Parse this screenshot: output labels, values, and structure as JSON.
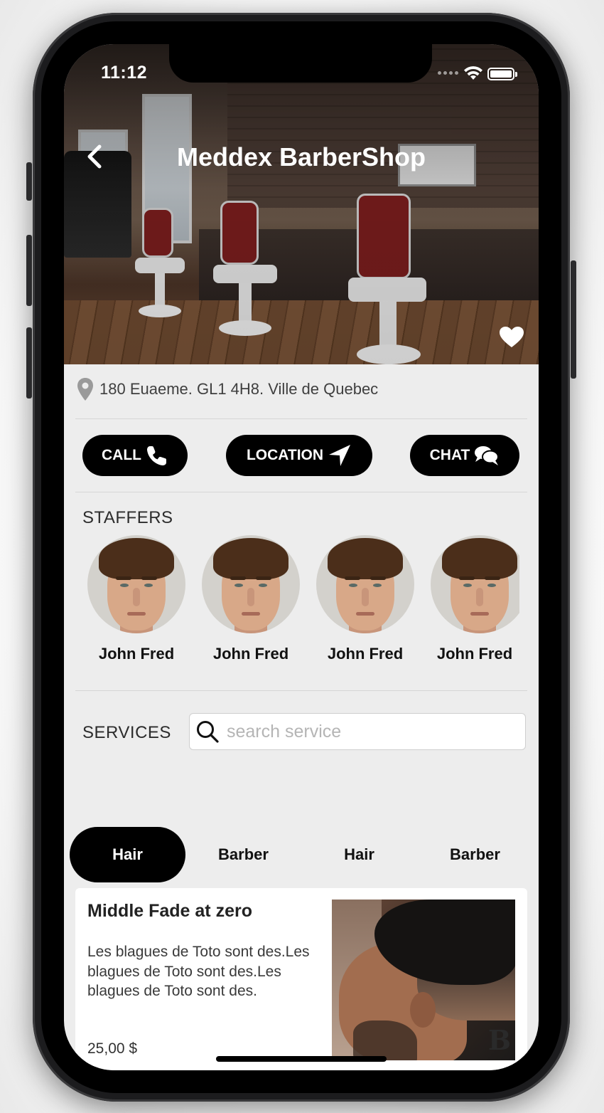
{
  "status_bar": {
    "time": "11:12"
  },
  "header": {
    "title": "Meddex BarberShop"
  },
  "address": {
    "text": "180 Euaeme. GL1 4H8. Ville de Quebec"
  },
  "actions": [
    {
      "label": "CALL",
      "icon": "phone-icon"
    },
    {
      "label": "LOCATION",
      "icon": "navigation-arrow-icon"
    },
    {
      "label": "CHAT",
      "icon": "chat-bubbles-icon"
    }
  ],
  "staffers": {
    "label": "STAFFERS",
    "items": [
      {
        "name": "John Fred"
      },
      {
        "name": "John Fred"
      },
      {
        "name": "John Fred"
      },
      {
        "name": "John Fred"
      }
    ]
  },
  "services": {
    "label": "SERVICES",
    "search_placeholder": "search service",
    "tabs": [
      {
        "label": "Hair",
        "active": true
      },
      {
        "label": "Barber",
        "active": false
      },
      {
        "label": "Hair",
        "active": false
      },
      {
        "label": "Barber",
        "active": false
      }
    ],
    "cards": [
      {
        "title": "Middle Fade at zero",
        "description": "Les blagues de Toto sont des.Les blagues de Toto sont des.Les blagues de Toto sont des.",
        "price": "25,00 $"
      }
    ]
  },
  "colors": {
    "accent": "#000000",
    "screen_bg": "#ededed",
    "card_bg": "#ffffff"
  }
}
